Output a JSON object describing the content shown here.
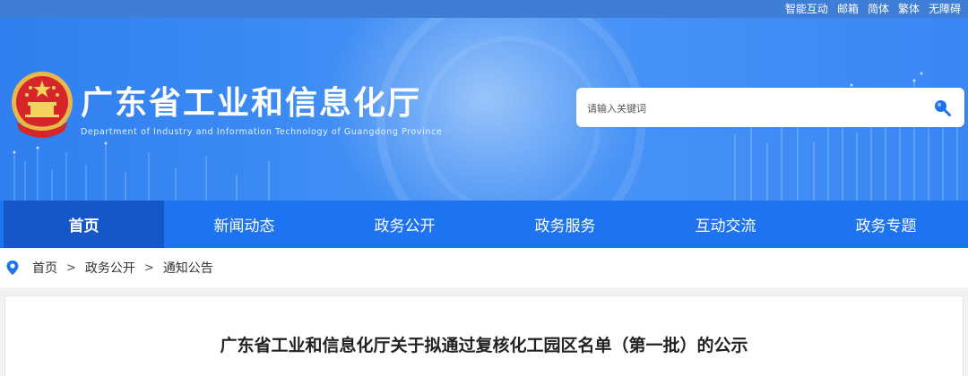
{
  "topbar": {
    "links": [
      "智能互动",
      "邮箱",
      "简体",
      "繁体",
      "无障碍"
    ]
  },
  "header": {
    "title": "广东省工业和信息化厅",
    "subtitle": "Department of Industry and Information Technology of Guangdong Province",
    "search": {
      "placeholder": "请输入关键词"
    },
    "emblem_icon": "national-emblem",
    "search_icon": "search-icon"
  },
  "nav": {
    "items": [
      "首页",
      "新闻动态",
      "政务公开",
      "政务服务",
      "互动交流",
      "政务专题"
    ],
    "active": "首页"
  },
  "breadcrumb": {
    "icon": "location-pin-icon",
    "items": [
      "首页",
      "政务公开",
      "通知公告"
    ],
    "separator": ">"
  },
  "article": {
    "title": "广东省工业和信息化厅关于拟通过复核化工园区名单（第一批）的公示"
  },
  "colors": {
    "nav_bg": "#1e73f0",
    "nav_active": "#1557c9",
    "header_blue": "#3a86f4",
    "pin": "#1e73f0"
  }
}
